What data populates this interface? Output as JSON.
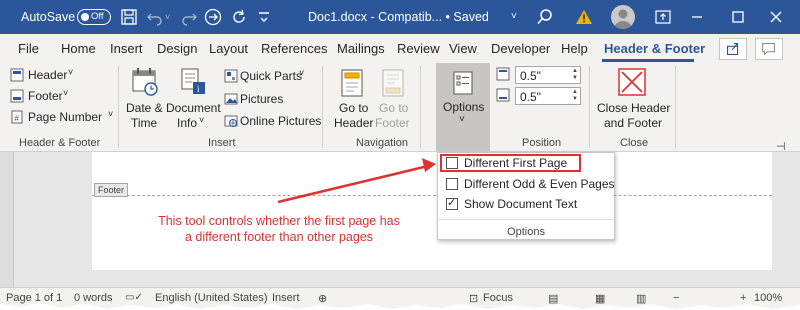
{
  "titlebar": {
    "autosave_label": "AutoSave",
    "autosave_state": "Off",
    "doc_title": "Doc1.docx  -  Compatib...  •  Saved",
    "doc_title_chevron": "˅",
    "save_icon": "save-icon",
    "colors": {
      "background": "#2b579a",
      "warning": "#f0b400"
    }
  },
  "tabs": {
    "items": [
      "File",
      "Home",
      "Insert",
      "Design",
      "Layout",
      "References",
      "Mailings",
      "Review",
      "View",
      "Developer",
      "Help",
      "Header & Footer"
    ],
    "active": "Header & Footer",
    "accent": "#2b579a"
  },
  "ribbon": {
    "header_footer": {
      "header": "Header",
      "footer": "Footer",
      "page_number": "Page Number",
      "group": "Header & Footer"
    },
    "insert": {
      "date_time_1": "Date &",
      "date_time_2": "Time",
      "doc_info_1": "Document",
      "doc_info_2": "Info",
      "quick_parts": "Quick Parts",
      "pictures": "Pictures",
      "online_pictures": "Online Pictures",
      "group": "Insert"
    },
    "navigation": {
      "goto_header_1": "Go to",
      "goto_header_2": "Header",
      "goto_footer_1": "Go to",
      "goto_footer_2": "Footer",
      "group": "Navigation"
    },
    "options": {
      "label": "Options",
      "chevron": "˅"
    },
    "position": {
      "header_from_top": "0.5\"",
      "footer_from_bottom": "0.5\"",
      "group": "Position"
    },
    "close": {
      "label_1": "Close Header",
      "label_2": "and Footer",
      "group": "Close",
      "accent": "#e03131"
    }
  },
  "options_menu": {
    "items": [
      {
        "label": "Different First Page",
        "checked": false
      },
      {
        "label": "Different Odd & Even Pages",
        "checked": false
      },
      {
        "label": "Show Document Text",
        "checked": true
      }
    ],
    "group": "Options"
  },
  "document": {
    "footer_tag": "Footer",
    "annotation_line1": "This tool controls whether the first page has",
    "annotation_line2": "a different footer than other pages",
    "annotation_color": "#e03131"
  },
  "statusbar": {
    "page": "Page 1 of 1",
    "words": "0 words",
    "language": "English (United States)",
    "mode": "Insert",
    "focus": "Focus",
    "zoom": "100%"
  }
}
